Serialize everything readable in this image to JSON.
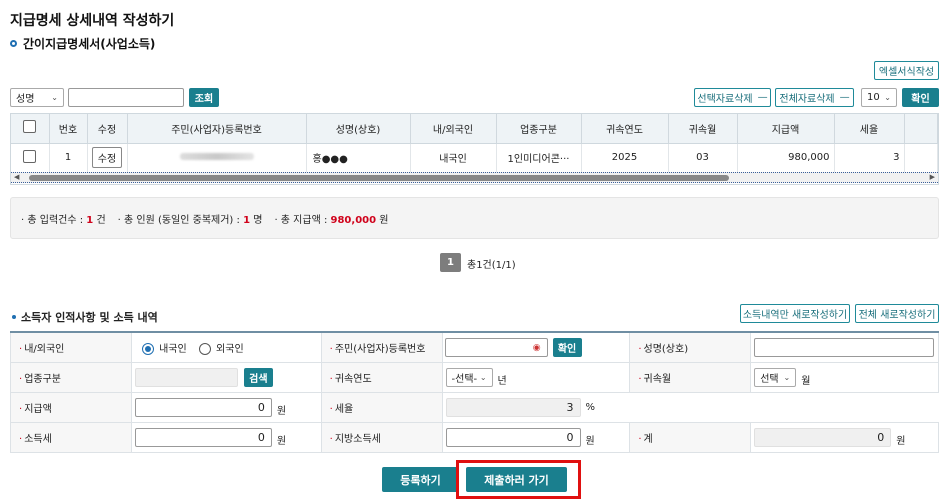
{
  "page": {
    "title": "지급명세 상세내역 작성하기",
    "subtitle": "간이지급명세서(사업소득)"
  },
  "toolbar": {
    "excel_button": "엑셀서식작성",
    "search_select": "성명",
    "search_button": "조회",
    "delete_selected": "선택자료삭제",
    "delete_all": "전체자료삭제",
    "page_size": "10",
    "confirm": "확인"
  },
  "grid": {
    "columns": [
      "번호",
      "수정",
      "주민(사업자)등록번호",
      "성명(상호)",
      "내/외국인",
      "업종구분",
      "귀속연도",
      "귀속월",
      "지급액",
      "세율"
    ],
    "rows": [
      {
        "no": "1",
        "edit": "수정",
        "name": "홍●●●",
        "nationality": "내국인",
        "industry": "1인미디어콘···",
        "year": "2025",
        "month": "03",
        "amount": "980,000",
        "rate": "3"
      }
    ]
  },
  "summary": {
    "count_label": "총 입력건수 :",
    "count_value": "1",
    "count_unit": "건",
    "persons_label": "총 인원 (동일인 중복제거) :",
    "persons_value": "1",
    "persons_unit": "명",
    "amount_label": "총 지급액 :",
    "amount_value": "980,000",
    "amount_unit": "원"
  },
  "pagination": {
    "current": "1",
    "total_text": "총1건(1/1)"
  },
  "section": {
    "title": "소득자 인적사항 및 소득 내역",
    "btn_income_only": "소득내역만 새로작성하기",
    "btn_all_new": "전체 새로작성하기"
  },
  "form": {
    "nationality_label": "내/외국인",
    "domestic": "내국인",
    "foreign": "외국인",
    "id_label": "주민(사업자)등록번호",
    "id_confirm": "확인",
    "name_label": "성명(상호)",
    "industry_label": "업종구분",
    "industry_search": "검색",
    "year_label": "귀속연도",
    "year_select": "-선택-",
    "year_unit": "년",
    "month_label": "귀속월",
    "month_select": "선택",
    "month_unit": "월",
    "amount_label": "지급액",
    "amount_value": "0",
    "amount_unit": "원",
    "rate_label": "세율",
    "rate_value": "3",
    "rate_unit": "%",
    "income_tax_label": "소득세",
    "income_tax_value": "0",
    "income_tax_unit": "원",
    "local_tax_label": "지방소득세",
    "local_tax_value": "0",
    "local_tax_unit": "원",
    "total_label": "계",
    "total_value": "0",
    "total_unit": "원"
  },
  "actions": {
    "register": "등록하기",
    "submit": "제출하러 가기"
  },
  "colors": {
    "teal": "#1a7f8e",
    "highlight": "#e01010",
    "red_text": "#d0021b"
  }
}
